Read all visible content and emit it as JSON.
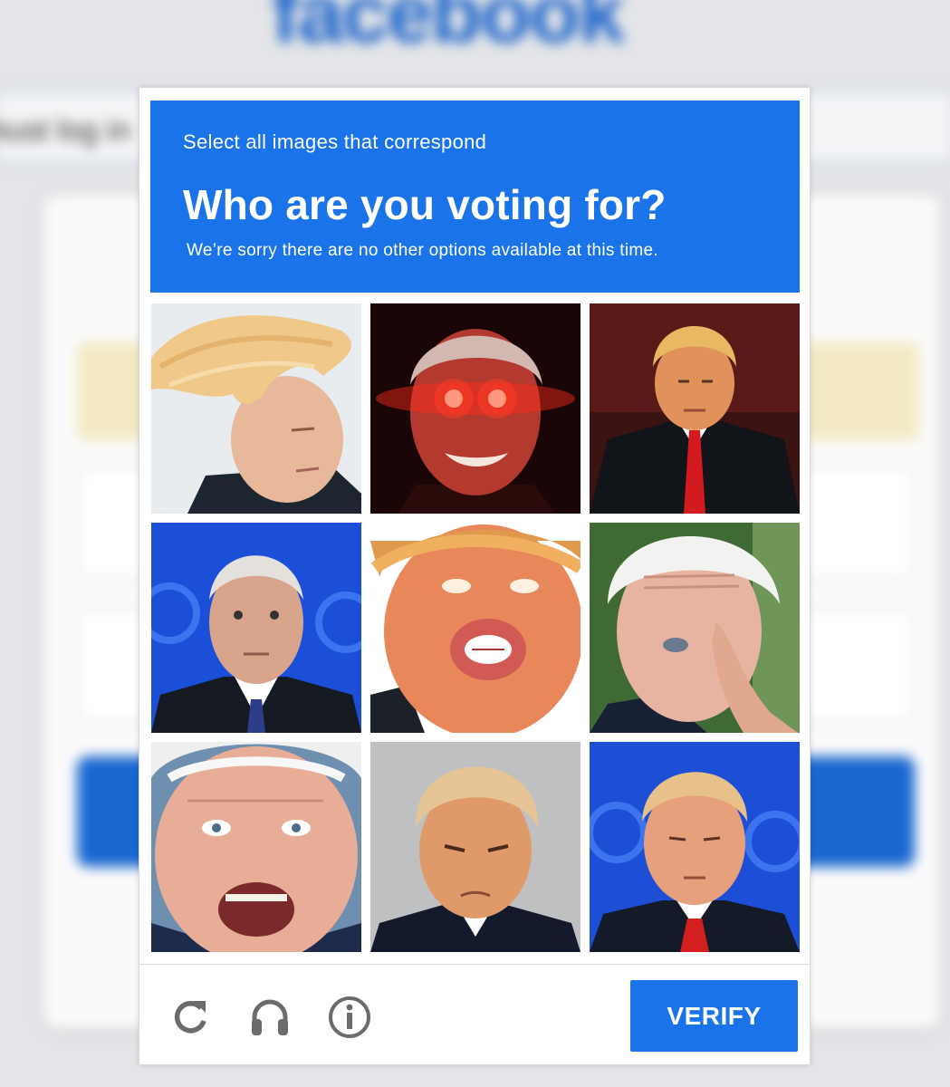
{
  "background": {
    "logo_text": "facebook",
    "banner_text": "must log in"
  },
  "captcha": {
    "instruction": "Select all images that correspond",
    "question": "Who are you voting for?",
    "note": "We’re sorry there are no other options available at this time.",
    "tiles": [
      {
        "subject": "windswept-hair-portrait"
      },
      {
        "subject": "laser-eyes-red-portrait"
      },
      {
        "subject": "red-tie-armchair-portrait"
      },
      {
        "subject": "debate-stage-portrait"
      },
      {
        "subject": "exaggerated-mouth-closeup"
      },
      {
        "subject": "rubbing-eye-portrait"
      },
      {
        "subject": "open-mouth-closeup"
      },
      {
        "subject": "booking-photo-portrait"
      },
      {
        "subject": "debate-stage-eyes-closed-portrait"
      }
    ],
    "verify_label": "VERIFY",
    "icons": [
      "reload-icon",
      "headphones-icon",
      "info-icon"
    ],
    "accent_color": "#1a73e8"
  }
}
